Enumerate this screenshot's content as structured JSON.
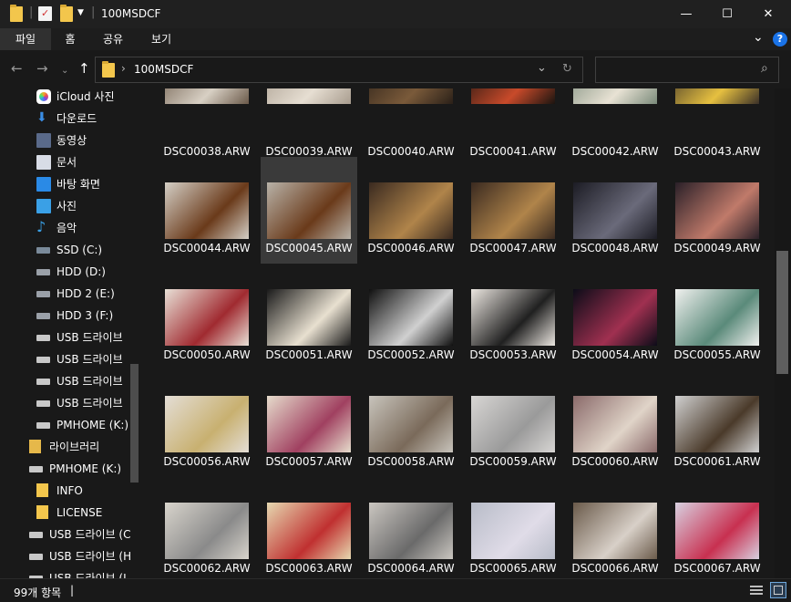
{
  "window": {
    "title": "100MSDCF",
    "separator": "|",
    "minimize": "—",
    "maximize": "☐",
    "close": "✕"
  },
  "ribbon": {
    "tabs": [
      "파일",
      "홈",
      "공유",
      "보기"
    ],
    "expand": "⌄",
    "help": "?"
  },
  "address": {
    "path": "100MSDCF",
    "chevron": "›",
    "dropdown": "⌄",
    "refresh": "↻",
    "search_placeholder": "",
    "search_icon": "⌕"
  },
  "sidebar": {
    "items": [
      {
        "label": "iCloud 사진",
        "icon": "icloud-photos-icon"
      },
      {
        "label": "다운로드",
        "icon": "download-icon"
      },
      {
        "label": "동영상",
        "icon": "video-icon"
      },
      {
        "label": "문서",
        "icon": "document-icon"
      },
      {
        "label": "바탕 화면",
        "icon": "desktop-icon"
      },
      {
        "label": "사진",
        "icon": "pictures-icon"
      },
      {
        "label": "음악",
        "icon": "music-icon"
      },
      {
        "label": "SSD (C:)",
        "icon": "ssd-drive-icon"
      },
      {
        "label": "HDD (D:)",
        "icon": "hdd-drive-icon"
      },
      {
        "label": "HDD 2 (E:)",
        "icon": "hdd-drive-icon"
      },
      {
        "label": "HDD 3 (F:)",
        "icon": "hdd-drive-icon"
      },
      {
        "label": "USB 드라이브",
        "icon": "usb-drive-icon"
      },
      {
        "label": "USB 드라이브",
        "icon": "usb-drive-icon"
      },
      {
        "label": "USB 드라이브",
        "icon": "usb-drive-icon"
      },
      {
        "label": "USB 드라이브",
        "icon": "usb-drive-icon"
      },
      {
        "label": "PMHOME (K:)",
        "icon": "usb-drive-icon"
      },
      {
        "label": "라이브러리",
        "icon": "library-icon"
      },
      {
        "label": "PMHOME (K:)",
        "icon": "usb-drive-icon"
      },
      {
        "label": "INFO",
        "icon": "folder-icon"
      },
      {
        "label": "LICENSE",
        "icon": "folder-icon"
      },
      {
        "label": "USB 드라이브 (C",
        "icon": "usb-drive-icon"
      },
      {
        "label": "USB 드라이브 (H",
        "icon": "usb-drive-icon"
      },
      {
        "label": "USB 드라이브 (I",
        "icon": "usb-drive-icon"
      }
    ]
  },
  "files": [
    "DSC00038.ARW",
    "DSC00039.ARW",
    "DSC00040.ARW",
    "DSC00041.ARW",
    "DSC00042.ARW",
    "DSC00043.ARW",
    "DSC00044.ARW",
    "DSC00045.ARW",
    "DSC00046.ARW",
    "DSC00047.ARW",
    "DSC00048.ARW",
    "DSC00049.ARW",
    "DSC00050.ARW",
    "DSC00051.ARW",
    "DSC00052.ARW",
    "DSC00053.ARW",
    "DSC00054.ARW",
    "DSC00055.ARW",
    "DSC00056.ARW",
    "DSC00057.ARW",
    "DSC00058.ARW",
    "DSC00059.ARW",
    "DSC00060.ARW",
    "DSC00061.ARW",
    "DSC00062.ARW",
    "DSC00063.ARW",
    "DSC00064.ARW",
    "DSC00065.ARW",
    "DSC00066.ARW",
    "DSC00067.ARW"
  ],
  "thumb_colors": [
    [
      "#6b5a4a",
      "#d8d0c4"
    ],
    [
      "#a89c8e",
      "#e6ded2"
    ],
    [
      "#2a2018",
      "#7a5a3a"
    ],
    [
      "#1a1410",
      "#c84a2a"
    ],
    [
      "#7a8a7a",
      "#e8e2d4"
    ],
    [
      "#3a3028",
      "#e6c040"
    ],
    [
      "#d4cfc6",
      "#6a3a1a"
    ],
    [
      "#b8b2a8",
      "#6a3a1a"
    ],
    [
      "#3a2a20",
      "#b0844a"
    ],
    [
      "#3a2a20",
      "#b0844a"
    ],
    [
      "#1c1c24",
      "#6a6a7a"
    ],
    [
      "#2a2028",
      "#c07a6a"
    ],
    [
      "#e8e0d6",
      "#a02a30"
    ],
    [
      "#1a1a1a",
      "#e8e0d0"
    ],
    [
      "#101010",
      "#d0d0d0"
    ],
    [
      "#ebe6e0",
      "#202020"
    ],
    [
      "#0c0c18",
      "#a03050"
    ],
    [
      "#f0f0ee",
      "#5a8a7a"
    ],
    [
      "#e4ded6",
      "#c8b070"
    ],
    [
      "#e6dccc",
      "#a04060"
    ],
    [
      "#c8c4bc",
      "#7a6a5a"
    ],
    [
      "#d8d6d4",
      "#9a9a9a"
    ],
    [
      "#8a6a6a",
      "#e0d4c8"
    ],
    [
      "#d0d0d0",
      "#4a3a2a"
    ],
    [
      "#d8d4cc",
      "#8a8a8a"
    ],
    [
      "#e6d8b0",
      "#c03030"
    ],
    [
      "#cac6c0",
      "#6a6a6a"
    ],
    [
      "#b8bcc8",
      "#e0dce8"
    ],
    [
      "#6a5a4a",
      "#d8d0c8"
    ],
    [
      "#d8d0e0",
      "#c83050"
    ]
  ],
  "selected_index": 7,
  "status": {
    "item_count": "99개 항목",
    "separator": "|"
  }
}
